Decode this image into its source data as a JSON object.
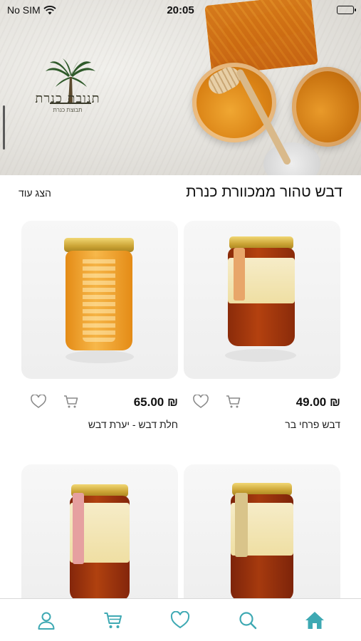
{
  "status_bar": {
    "carrier": "No SIM",
    "time": "20:05"
  },
  "hero": {
    "logo_title": "תנובת כנרת",
    "logo_subtitle": "תבוצת כנרת"
  },
  "section": {
    "title": "דבש טהור ממכוורת כנרת",
    "show_more": "הצג עוד"
  },
  "products": [
    {
      "name": "דבש פרחי בר",
      "price": "₪ 49.00"
    },
    {
      "name": "חלת דבש - יערת דבש",
      "price": "₪ 65.00"
    },
    {
      "name": "",
      "price": ""
    },
    {
      "name": "",
      "price": ""
    }
  ],
  "colors": {
    "accent": "#3ea9b3",
    "icon_gray": "#8a8a8a"
  },
  "nav": [
    {
      "icon": "home-icon",
      "active": true
    },
    {
      "icon": "search-icon"
    },
    {
      "icon": "heart-icon"
    },
    {
      "icon": "cart-icon"
    },
    {
      "icon": "user-icon"
    }
  ]
}
